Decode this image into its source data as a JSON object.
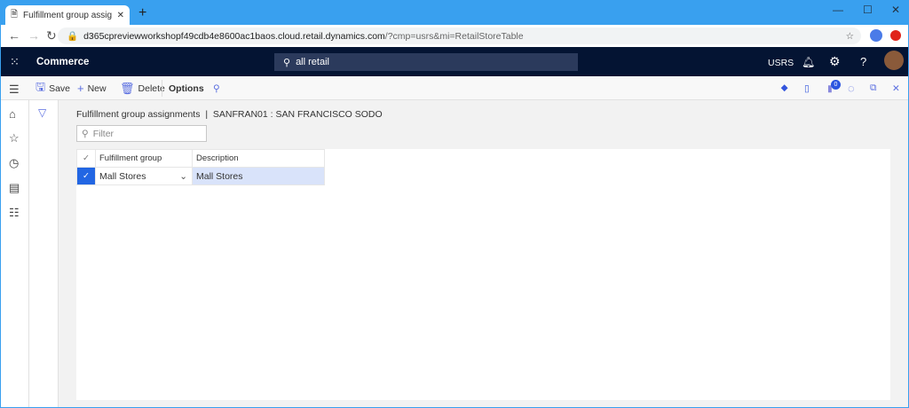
{
  "browser": {
    "tab_title": "Fulfillment group assignments --",
    "url": "d365cpreviewworkshopf49cdb4e8600ac1baos.cloud.retail.dynamics.com/?cmp=usrs&mi=RetailStoreTable",
    "url_host": "d365cpreviewworkshopf49cdb4e8600ac1baos.cloud.retail.dynamics.com",
    "url_query": "/?cmp=usrs&mi=RetailStoreTable"
  },
  "nav": {
    "app_name": "Commerce",
    "search_value": "all retail",
    "company": "USRS"
  },
  "actions": {
    "save": "Save",
    "new": "New",
    "delete": "Delete",
    "options": "Options",
    "badge_count": "0"
  },
  "page": {
    "breadcrumb": "Fulfillment group assignments  |  SANFRAN01 : SAN FRANCISCO SODO",
    "filter_placeholder": "Filter"
  },
  "grid": {
    "columns": [
      "Fulfillment group",
      "Description"
    ],
    "rows": [
      {
        "group": "Mall Stores",
        "description": "Mall Stores"
      }
    ]
  }
}
